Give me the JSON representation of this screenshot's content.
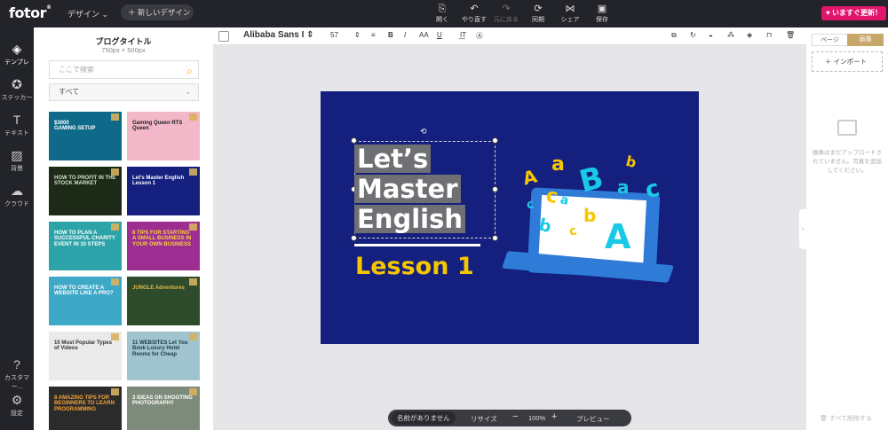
{
  "app": {
    "logo": "fotor",
    "design_menu": "デザイン ⌄",
    "new_design": "＋ 新しいデザイン",
    "upgrade": "♥ いますぐ更新！"
  },
  "topbar": {
    "actions": [
      {
        "icon": "open-icon",
        "glyph": "⎘",
        "label": "開く"
      },
      {
        "icon": "undo-icon",
        "glyph": "↶",
        "label": "やり直す"
      },
      {
        "icon": "redo-icon",
        "glyph": "↷",
        "label": "元に戻る",
        "disabled": true
      },
      {
        "icon": "sync-icon",
        "glyph": "⟳",
        "label": "同期"
      },
      {
        "icon": "share-icon",
        "glyph": "⋈",
        "label": "シェア"
      },
      {
        "icon": "save-icon",
        "glyph": "▣",
        "label": "保存"
      }
    ]
  },
  "leftnav": [
    {
      "icon": "template-icon",
      "glyph": "◈",
      "label": "テンプレ",
      "active": true
    },
    {
      "icon": "sticker-icon",
      "glyph": "✪",
      "label": "ステッカー"
    },
    {
      "icon": "text-icon",
      "glyph": "T",
      "label": "テキスト"
    },
    {
      "icon": "background-icon",
      "glyph": "▨",
      "label": "背景"
    },
    {
      "icon": "cloud-icon",
      "glyph": "☁",
      "label": "クラウド"
    },
    {
      "icon": "help-icon",
      "glyph": "?",
      "label": "カスタマー..."
    },
    {
      "icon": "settings-icon",
      "glyph": "⚙",
      "label": "設定"
    }
  ],
  "panel": {
    "title": "ブログタイトル",
    "subtitle": "750px × 500px",
    "search_placeholder": "ここで検索",
    "category": "すべて",
    "thumbs": [
      {
        "text": "$3000\nGAMING SETUP",
        "bg": "#0f6a8a",
        "color": "#ffffff"
      },
      {
        "text": "Gaming Queen  RTS Queen",
        "bg": "#f2b7c8",
        "color": "#222222"
      },
      {
        "text": "HOW TO PROFIT IN THE STOCK MARKET",
        "bg": "#1d2a18",
        "color": "#cfe0c8"
      },
      {
        "text": "Let's Master English\nLesson 1",
        "bg": "#141f7e",
        "color": "#ffffff"
      },
      {
        "text": "HOW TO PLAN A SUCCESSFUL CHARITY EVENT IN 10 STEPS",
        "bg": "#2ba3a8",
        "color": "#ffffff"
      },
      {
        "text": "8 TIPS FOR STARTING A SMALL BUSINESS IN YOUR OWN BUSINESS",
        "bg": "#9d2d91",
        "color": "#f6d33c"
      },
      {
        "text": "HOW TO CREATE A WEBSITE LIKE A PRO?",
        "bg": "#3ea8c7",
        "color": "#ffffff"
      },
      {
        "text": "JUNGLE Adventures",
        "bg": "#2e4c2c",
        "color": "#e2b648"
      },
      {
        "text": "10 Most Popular Types of Videos",
        "bg": "#eaeaea",
        "color": "#333333"
      },
      {
        "text": "11 WEBSITES Let You Book Luxury Hotel Rooms for Cheap",
        "bg": "#9fc4cf",
        "color": "#1b3b4a"
      },
      {
        "text": "8 AMAZING TIPS FOR BEGINNERS TO LEARN PROGRAMMING",
        "bg": "#2b2b2b",
        "color": "#f2a23a"
      },
      {
        "text": "3 IDEAS ON SHOOTING PHOTOGRAPHY",
        "bg": "#7d8b7a",
        "color": "#ffffff"
      }
    ]
  },
  "format_bar": {
    "font": "Alibaba Sans I",
    "size": "57"
  },
  "canvas": {
    "lines": [
      "Let’s",
      "Master",
      "English"
    ],
    "lesson": "Lesson 1",
    "letters": [
      "A",
      "a",
      "c",
      "B",
      "a",
      "b",
      "c",
      "A",
      "b",
      "c",
      "b",
      "a",
      "c"
    ]
  },
  "bottombar": {
    "name": "名前がありません",
    "resize": "リサイズ",
    "zoom": "100%",
    "preview": "プレビュー"
  },
  "rightpanel": {
    "tab_page": "ページ",
    "tab_image": "画像",
    "import": "＋ インポート",
    "empty": "画像はまだアップロードされていません。写真を追加してください。",
    "delete_all": "🗑 すべて削除する"
  }
}
